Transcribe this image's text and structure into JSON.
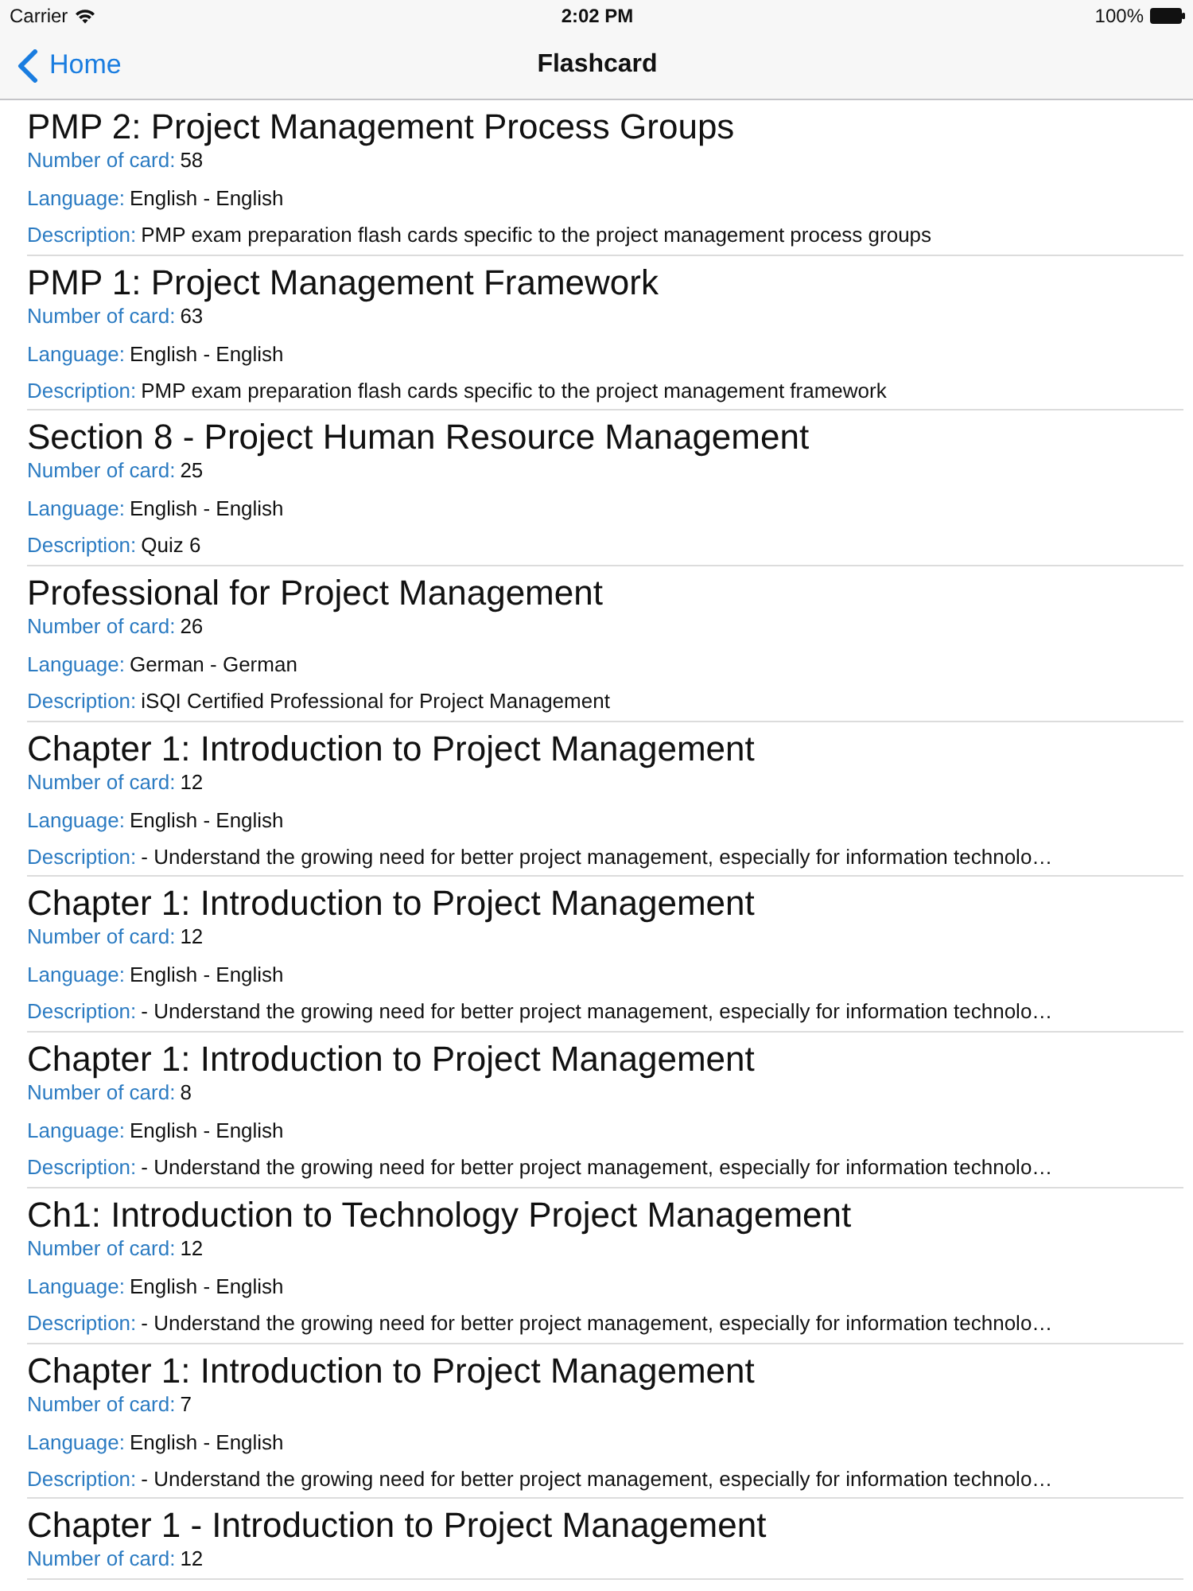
{
  "status_bar": {
    "carrier": "Carrier",
    "time": "2:02 PM",
    "battery": "100%"
  },
  "nav_bar": {
    "back": "Home",
    "title": "Flashcard"
  },
  "decks": [
    {
      "title": "PMP 2: Project Management Process Groups",
      "fields": [
        {
          "label": "Number of card:",
          "value": "58"
        },
        {
          "label": "Language:",
          "value": "English - English"
        },
        {
          "label": "Description:",
          "value": "PMP exam preparation flash cards specific to the project management process groups"
        }
      ]
    },
    {
      "title": "PMP 1: Project Management Framework",
      "fields": [
        {
          "label": "Number of card:",
          "value": "63"
        },
        {
          "label": "Language:",
          "value": "English - English"
        },
        {
          "label": "Description:",
          "value": "PMP exam preparation flash cards specific to the project management framework"
        }
      ]
    },
    {
      "title": "Section 8 - Project Human Resource Management",
      "fields": [
        {
          "label": "Number of card:",
          "value": "25"
        },
        {
          "label": "Language:",
          "value": "English - English"
        },
        {
          "label": "Description:",
          "value": "Quiz 6"
        }
      ]
    },
    {
      "title": "Professional for Project Management",
      "fields": [
        {
          "label": "Number of card:",
          "value": "26"
        },
        {
          "label": "Language:",
          "value": "German - German"
        },
        {
          "label": "Description:",
          "value": "iSQI Certified Professional for Project Management"
        }
      ]
    },
    {
      "title": "Chapter 1: Introduction to Project Management",
      "fields": [
        {
          "label": "Number of card:",
          "value": "12"
        },
        {
          "label": "Language:",
          "value": "English - English"
        },
        {
          "label": "Description:",
          "value": "- Understand the growing need for better project management, especially for information technolo…"
        }
      ]
    },
    {
      "title": "Chapter 1: Introduction to Project Management",
      "fields": [
        {
          "label": "Number of card:",
          "value": "12"
        },
        {
          "label": "Language:",
          "value": "English - English"
        },
        {
          "label": "Description:",
          "value": "- Understand the growing need for better project management, especially for information technolo…"
        }
      ]
    },
    {
      "title": "Chapter 1: Introduction to Project Management",
      "fields": [
        {
          "label": "Number of card:",
          "value": "8"
        },
        {
          "label": "Language:",
          "value": "English - English"
        },
        {
          "label": "Description:",
          "value": "- Understand the growing need for better project management, especially for information technolo…"
        }
      ]
    },
    {
      "title": "Ch1: Introduction to Technology Project Management",
      "fields": [
        {
          "label": "Number of card:",
          "value": "12"
        },
        {
          "label": "Language:",
          "value": "English - English"
        },
        {
          "label": "Description:",
          "value": "- Understand the growing need for better project management, especially for information technolo…"
        }
      ]
    },
    {
      "title": "Chapter 1: Introduction to Project Management",
      "fields": [
        {
          "label": "Number of card:",
          "value": "7"
        },
        {
          "label": "Language:",
          "value": "English - English"
        },
        {
          "label": "Description:",
          "value": "- Understand the growing need for better project management, especially for information technolo…"
        }
      ]
    },
    {
      "title": "Chapter 1 - Introduction to Project Management",
      "fields": [
        {
          "label": "Number of card:",
          "value": "12"
        }
      ]
    }
  ]
}
